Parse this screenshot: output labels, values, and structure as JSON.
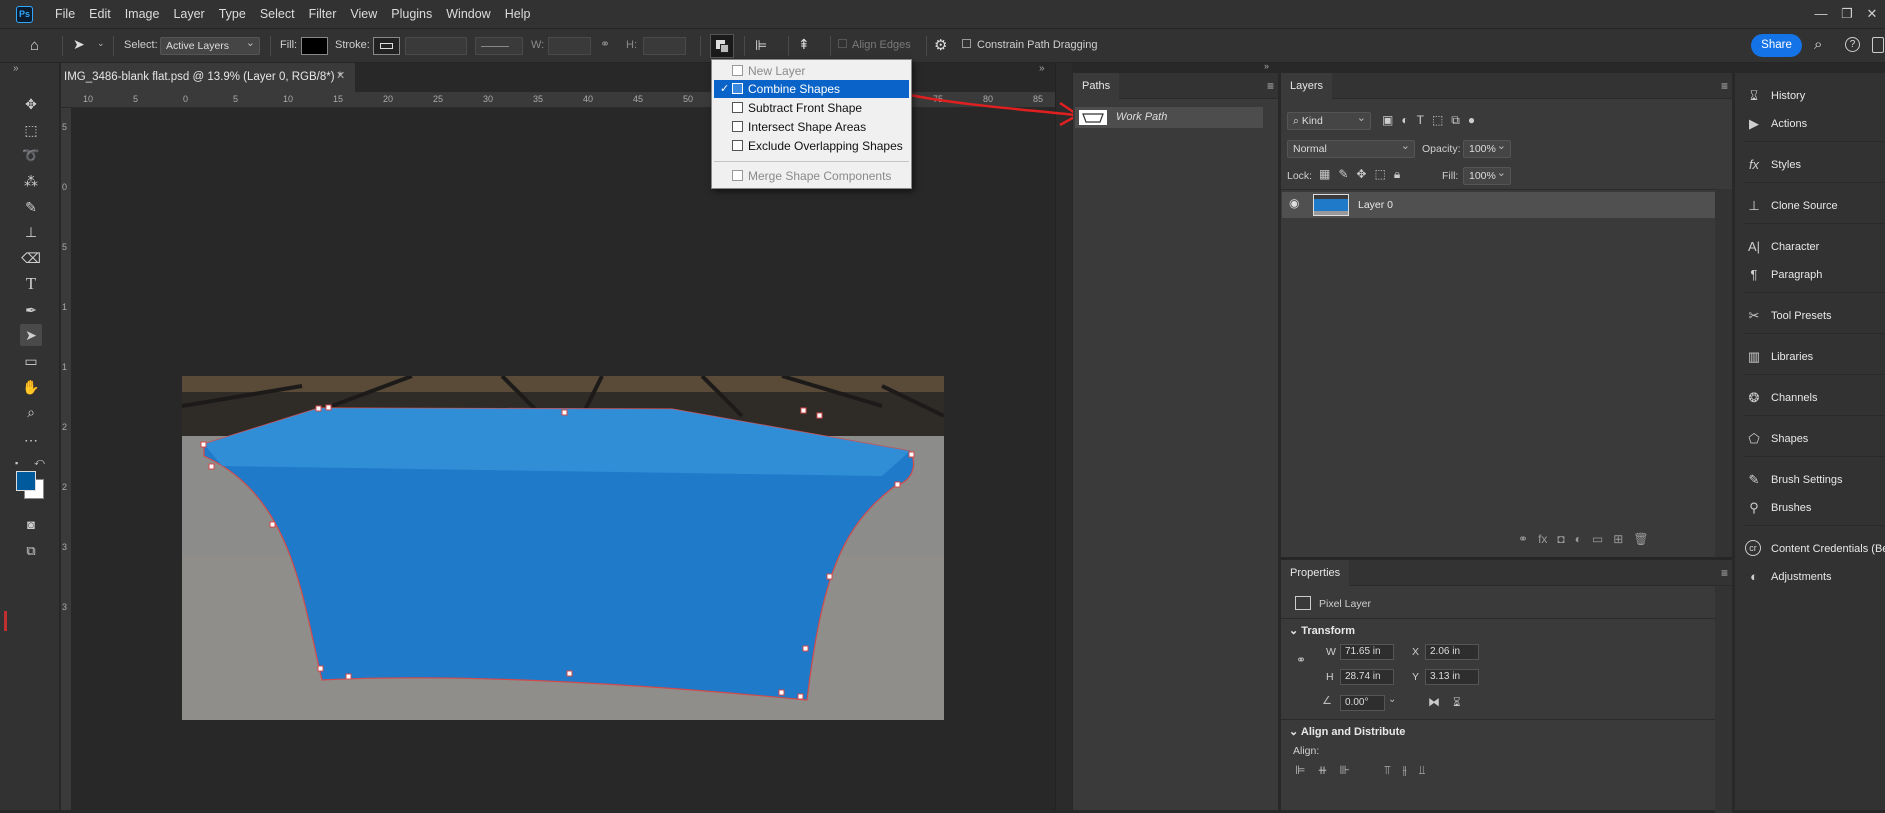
{
  "app": {
    "logo": "Ps"
  },
  "menu": [
    "File",
    "Edit",
    "Image",
    "Layer",
    "Type",
    "Select",
    "Filter",
    "View",
    "Plugins",
    "Window",
    "Help"
  ],
  "options": {
    "select_label": "Select:",
    "select_value": "Active Layers",
    "fill_label": "Fill:",
    "stroke_label": "Stroke:",
    "w_label": "W:",
    "h_label": "H:",
    "align_edges": "Align Edges",
    "constrain": "Constrain Path Dragging",
    "share": "Share"
  },
  "document": {
    "tab_title": "IMG_3486-blank flat.psd @ 13.9% (Layer 0, RGB/8*) *",
    "ruler_top": [
      "10",
      "5",
      "0",
      "5",
      "10",
      "15",
      "20",
      "25",
      "30",
      "35",
      "40",
      "45",
      "50",
      "55",
      "60",
      "65",
      "70",
      "75",
      "80",
      "85"
    ],
    "ruler_left": [
      "5",
      "0",
      "5",
      "1",
      "1",
      "2",
      "2",
      "3",
      "3"
    ]
  },
  "path_ops_menu": {
    "items": [
      {
        "label": "New Layer",
        "state": "disabled"
      },
      {
        "label": "Combine Shapes",
        "state": "selected"
      },
      {
        "label": "Subtract Front Shape",
        "state": "normal"
      },
      {
        "label": "Intersect Shape Areas",
        "state": "normal"
      },
      {
        "label": "Exclude Overlapping Shapes",
        "state": "normal"
      },
      {
        "label": "Merge Shape Components",
        "state": "disabled"
      }
    ]
  },
  "paths_panel": {
    "tab": "Paths",
    "items": [
      "Work Path"
    ]
  },
  "layers_panel": {
    "tab": "Layers",
    "filter": "Kind",
    "blend_mode": "Normal",
    "opacity_label": "Opacity:",
    "opacity": "100%",
    "lock_label": "Lock:",
    "fill_label": "Fill:",
    "fill": "100%",
    "layers": [
      {
        "name": "Layer 0",
        "visible": true
      }
    ]
  },
  "properties": {
    "tab": "Properties",
    "kind": "Pixel Layer",
    "transform_title": "Transform",
    "w_label": "W",
    "w": "71.65 in",
    "h_label": "H",
    "h": "28.74 in",
    "x_label": "X",
    "x": "2.06 in",
    "y_label": "Y",
    "y": "3.13 in",
    "angle": "0.00°",
    "align_title": "Align and Distribute",
    "align_label": "Align:"
  },
  "dock": [
    "History",
    "Actions",
    "Styles",
    "Clone Source",
    "Character",
    "Paragraph",
    "Tool Presets",
    "Libraries",
    "Channels",
    "Shapes",
    "Brush Settings",
    "Brushes",
    "Content Credentials (Beta)",
    "Adjustments"
  ],
  "colors": {
    "accent": "#1473e6",
    "menu_selected": "#0a63c9",
    "annotation": "#e02020",
    "tablecloth": "#1f7bc9"
  }
}
